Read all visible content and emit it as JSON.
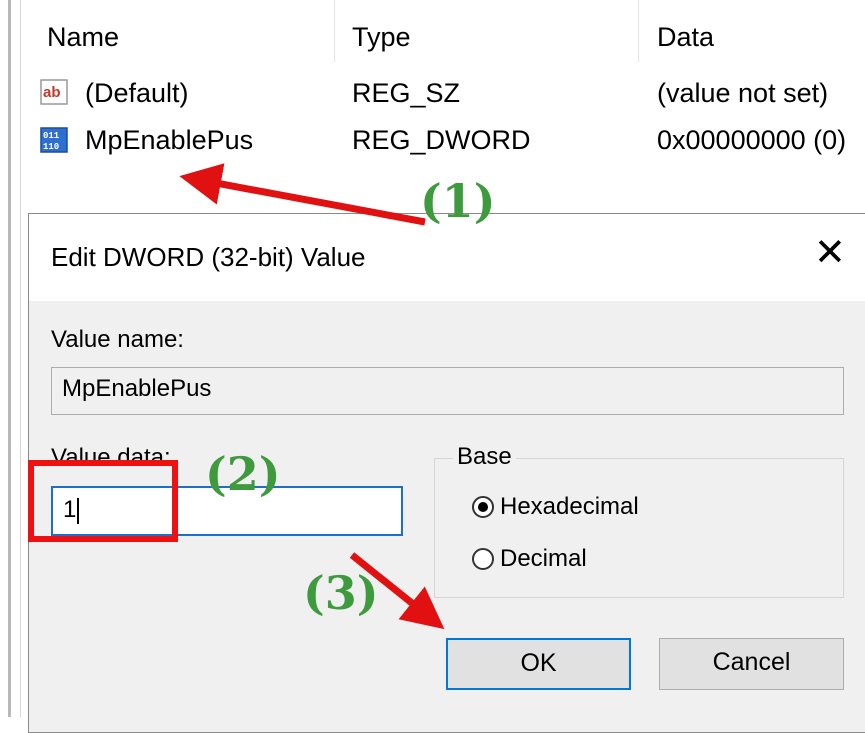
{
  "registry": {
    "columns": {
      "name": "Name",
      "type": "Type",
      "data": "Data"
    },
    "rows": [
      {
        "name": "(Default)",
        "type": "REG_SZ",
        "data": "(value not set)",
        "icon": "ab-string-icon"
      },
      {
        "name": "MpEnablePus",
        "type": "REG_DWORD",
        "data": "0x00000000 (0)",
        "icon": "binary-dword-icon"
      }
    ]
  },
  "dialog": {
    "title": "Edit DWORD (32-bit) Value",
    "value_name_label": "Value name:",
    "value_name": "MpEnablePus",
    "value_data_label": "Value data:",
    "value_data": "1",
    "base_label": "Base",
    "base_options": [
      {
        "label": "Hexadecimal",
        "checked": true
      },
      {
        "label": "Decimal",
        "checked": false
      }
    ],
    "ok_label": "OK",
    "cancel_label": "Cancel"
  },
  "annotations": {
    "step1": "(1)",
    "step2": "(2)",
    "step3": "(3)",
    "number_color": "#3d9a3d",
    "arrow_color": "#e11111"
  }
}
